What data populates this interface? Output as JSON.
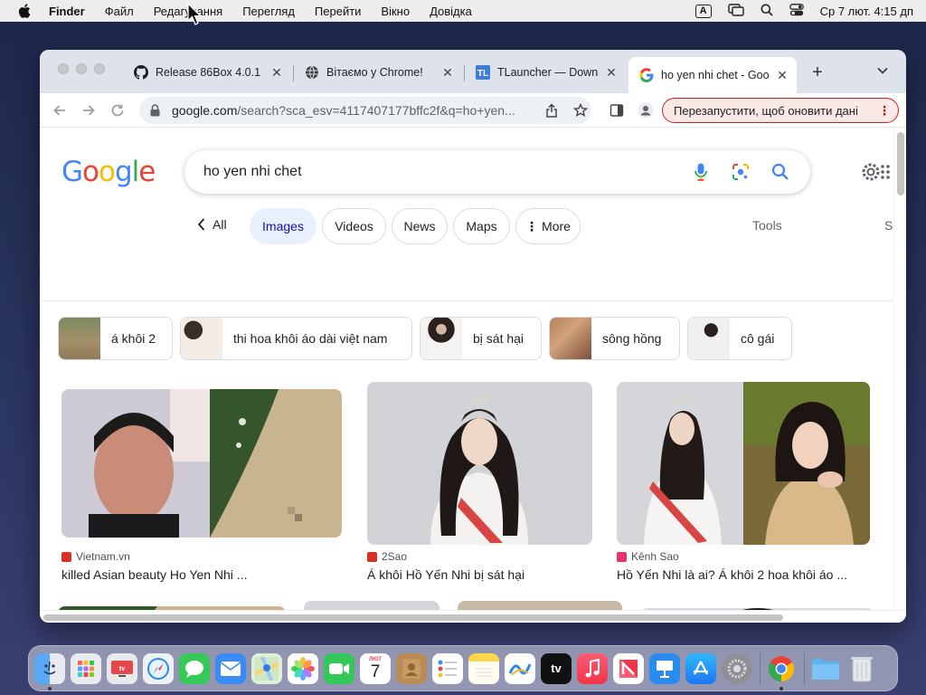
{
  "menubar": {
    "app": "Finder",
    "items": [
      "Файл",
      "Редагування",
      "Перегляд",
      "Перейти",
      "Вікно",
      "Довідка"
    ],
    "input_badge": "A",
    "datetime": "Ср 7 лют.  4:15 дп"
  },
  "browser": {
    "tabs": [
      {
        "title": "Release 86Box 4.0.1",
        "icon": "github-icon"
      },
      {
        "title": "Вітаємо у Chrome!",
        "icon": "globe-icon"
      },
      {
        "title": "TLauncher — Downlo",
        "icon": "tlauncher-icon"
      },
      {
        "title": "ho yen nhi chet - Goo",
        "icon": "google-icon",
        "active": true
      }
    ],
    "url_host": "google.com",
    "url_rest": "/search?sca_esv=4117407177bffc2f&q=ho+yen...",
    "update_button": "Перезапустити, щоб оновити дані"
  },
  "search": {
    "logo": "Google",
    "query": "ho yen nhi chet",
    "back_label": "All",
    "filters": [
      "Images",
      "Videos",
      "News",
      "Maps",
      "More"
    ],
    "active_filter": "Images",
    "tools": "Tools",
    "edge_label": "S"
  },
  "related": [
    {
      "label": "á khôi 2"
    },
    {
      "label": "thi hoa khôi áo dài việt nam"
    },
    {
      "label": "bị sát hại"
    },
    {
      "label": "sông hồng"
    },
    {
      "label": "cô gái"
    }
  ],
  "results": [
    {
      "source": "Vietnam.vn",
      "caption": "killed Asian beauty Ho Yen Nhi ...",
      "source_color": "#d93025"
    },
    {
      "source": "2Sao",
      "caption": "Á khôi Hồ Yến Nhi bị sát hại",
      "source_color": "#d93025"
    },
    {
      "source": "Kênh Sao",
      "caption": "Hồ Yến Nhi là ai? Á khôi 2 hoa khôi áo ...",
      "source_color": "#e8336d"
    }
  ],
  "dock": {
    "calendar_month": "ЛЮТ",
    "calendar_day": "7",
    "apps": [
      "finder-icon",
      "launchpad-icon",
      "tv-icon",
      "safari-icon",
      "messages-icon",
      "mail-icon",
      "maps-icon",
      "photos-icon",
      "facetime-icon",
      "calendar-icon",
      "contacts-icon",
      "reminders-icon",
      "notes-icon",
      "freeform-icon",
      "appletv-icon",
      "music-icon",
      "news-icon",
      "keynote-icon",
      "appstore-icon",
      "settings-icon",
      "chrome-icon",
      "downloads-folder-icon",
      "trash-icon"
    ]
  },
  "colors": {
    "google_blue": "#4285f4",
    "google_red": "#ea4335",
    "google_yellow": "#fbbc05",
    "google_green": "#34a853",
    "chip_active_bg": "#e8f0fe",
    "update_border": "#c5221f"
  }
}
